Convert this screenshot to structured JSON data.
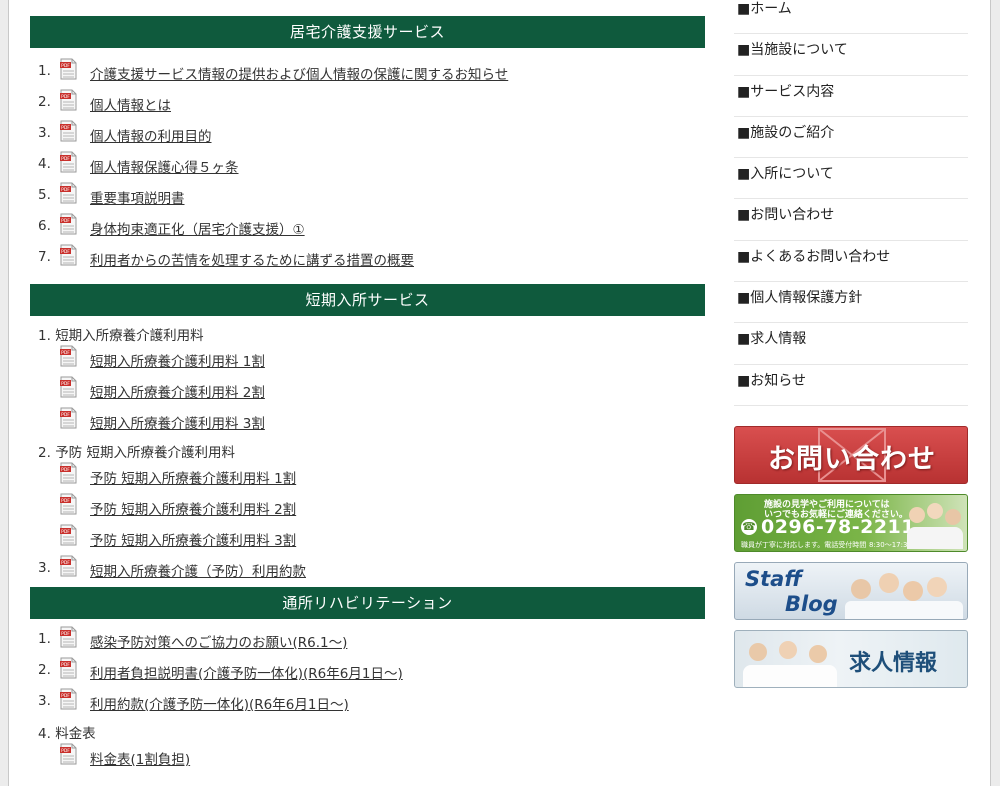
{
  "sections": [
    {
      "title": "居宅介護支援サービス",
      "items": [
        {
          "num": "1.",
          "label": "介護支援サービス情報の提供および個人情報の保護に関するお知らせ"
        },
        {
          "num": "2.",
          "label": "個人情報とは"
        },
        {
          "num": "3.",
          "label": "個人情報の利用目的"
        },
        {
          "num": "4.",
          "label": "個人情報保護心得５ヶ条"
        },
        {
          "num": "5.",
          "label": "重要事項説明書"
        },
        {
          "num": "6.",
          "label": "身体拘束適正化（居宅介護支援）①"
        },
        {
          "num": "7.",
          "label": "利用者からの苦情を処理するために講ずる措置の概要"
        }
      ]
    },
    {
      "title": "短期入所サービス",
      "groups": [
        {
          "num": "1.",
          "label": "短期入所療養介護利用料",
          "subs": [
            "短期入所療養介護利用料 1割",
            "短期入所療養介護利用料 2割",
            "短期入所療養介護利用料 3割"
          ]
        },
        {
          "num": "2.",
          "label": "予防 短期入所療養介護利用料",
          "subs": [
            "予防 短期入所療養介護利用料 1割",
            "予防 短期入所療養介護利用料 2割",
            "予防 短期入所療養介護利用料 3割"
          ]
        }
      ],
      "last": {
        "num": "3.",
        "label": "短期入所療養介護（予防）利用約款"
      }
    },
    {
      "title": "通所リハビリテーション",
      "items": [
        {
          "num": "1.",
          "label": "感染予防対策へのご協力のお願い(R6.1～)"
        },
        {
          "num": "2.",
          "label": "利用者負担説明書(介護予防一体化)(R6年6月1日～)"
        },
        {
          "num": "3.",
          "label": "利用約款(介護予防一体化)(R6年6月1日～)"
        }
      ],
      "group": {
        "num": "4.",
        "label": "料金表",
        "subs": [
          "料金表(1割負担)"
        ]
      }
    }
  ],
  "sidebar": {
    "nav": [
      "■ホーム",
      "■当施設について",
      "■サービス内容",
      "■施設のご紹介",
      "■入所について",
      "■お問い合わせ",
      "■よくあるお問い合わせ",
      "■個人情報保護方針",
      "■求人情報",
      "■お知らせ"
    ],
    "banner_contact": "お問い合わせ",
    "banner_phone_line1": "施設の見学やご利用については",
    "banner_phone_line2": "いつでもお気軽にご連絡ください。",
    "banner_phone_number": "0296-78-2211",
    "banner_phone_note": "職員が丁寧に対応します。電話受付時間",
    "banner_phone_hours": "8:30～17:30",
    "banner_staff_1": "Staff",
    "banner_staff_2": "Blog",
    "banner_recruit": "求人情報"
  },
  "colors": {
    "section_header": "#0f5a3d",
    "contact_banner": "#c83e3e",
    "phone_banner": "#6aa53a"
  }
}
